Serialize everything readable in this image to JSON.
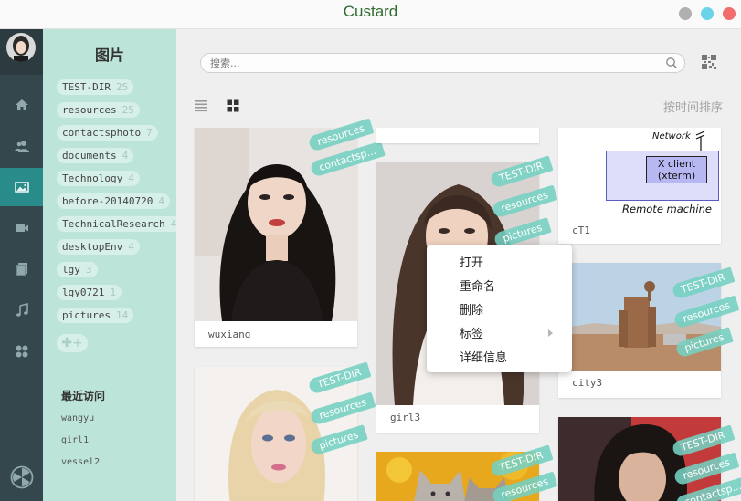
{
  "window": {
    "title": "Custard"
  },
  "tags_panel": {
    "title": "图片",
    "tags": [
      {
        "name": "TEST-DIR",
        "count": "25"
      },
      {
        "name": "resources",
        "count": "25"
      },
      {
        "name": "contactsphoto",
        "count": "7"
      },
      {
        "name": "documents",
        "count": "4"
      },
      {
        "name": "Technology",
        "count": "4"
      },
      {
        "name": "before-20140720",
        "count": "4"
      },
      {
        "name": "TechnicalResearch",
        "count": "4"
      },
      {
        "name": "desktopEnv",
        "count": "4"
      },
      {
        "name": "lgy",
        "count": "3"
      },
      {
        "name": "lgy0721",
        "count": "1"
      },
      {
        "name": "pictures",
        "count": "14"
      }
    ],
    "add_label": "✚+",
    "recent_title": "最近访问",
    "recent": [
      "wangyu",
      "girl1",
      "vessel2"
    ]
  },
  "toolbar": {
    "search_placeholder": "搜索...",
    "sort_label": "按时间排序"
  },
  "cards": {
    "wuxiang": {
      "caption": "wuxiang",
      "ribbons": [
        "resources",
        "contactsp..."
      ]
    },
    "girl3": {
      "caption": "girl3",
      "ribbons": [
        "TEST-DIR",
        "resources",
        "pictures"
      ]
    },
    "ct1": {
      "caption": "cT1",
      "diagram_network": "Network",
      "diagram_box": "X client\n(xterm)",
      "diagram_machine": "Remote machine"
    },
    "city3": {
      "caption": "city3",
      "ribbons": [
        "TEST-DIR",
        "resources",
        "pictures"
      ]
    },
    "blonde": {
      "ribbons": [
        "TEST-DIR",
        "resources",
        "pictures"
      ]
    },
    "cat": {
      "ribbons": [
        "TEST-DIR",
        "resources"
      ]
    },
    "man": {
      "ribbons": [
        "TEST-DIR",
        "resources",
        "contactsp..."
      ]
    }
  },
  "context_menu": {
    "items": [
      "打开",
      "重命名",
      "删除",
      "标签",
      "详细信息"
    ]
  },
  "colors": {
    "rail_bg": "#34474d",
    "rail_active": "#2a8c8a",
    "panel_bg": "#bde4d9",
    "ribbon": "#74d0c1",
    "title_green": "#2f6b2f"
  },
  "icons": [
    "home-icon",
    "contacts-icon",
    "picture-icon",
    "video-icon",
    "document-icon",
    "music-icon",
    "apps-icon",
    "settings-icon",
    "search-icon",
    "qrcode-icon",
    "list-view-icon",
    "grid-view-icon",
    "chevron-right-icon"
  ]
}
